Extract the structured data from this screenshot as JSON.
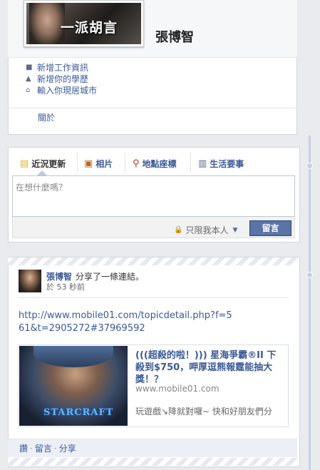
{
  "profile": {
    "name": "張博智",
    "picture_caption": "一派胡言",
    "info": [
      {
        "icon": "briefcase-icon",
        "label": "新增工作資訊"
      },
      {
        "icon": "graduation-cap-icon",
        "label": "新增你的學歷"
      },
      {
        "icon": "house-icon",
        "label": "輸入你現居城市"
      }
    ],
    "about_link": "關於"
  },
  "composer": {
    "tabs": [
      {
        "icon": "status-icon",
        "label": "近況更新"
      },
      {
        "icon": "photo-icon",
        "label": "相片"
      },
      {
        "icon": "place-icon",
        "label": "地點座標"
      },
      {
        "icon": "life-event-icon",
        "label": "生活要事"
      }
    ],
    "placeholder": "在想什麼嗎？",
    "privacy_label": "只限我本人",
    "post_button": "留言"
  },
  "story": {
    "author": "張博智",
    "action": "分享了一條連結。",
    "time": "於 53 秒前",
    "url": "http://www.mobile01.com/topicdetail.php?f=561&t=2905272#37969592",
    "share": {
      "title": "(((超殺的啦！))) 星海爭霸®II 下殺到$750，呷厚逗熊報霆能抽大獎！？",
      "domain": "www.mobile01.com",
      "description": "玩遊戲↘降就對囉~ 快和好朋友們分",
      "image_caption": "STARCRAFT"
    },
    "actions": [
      "讚",
      "留言",
      "分享"
    ]
  },
  "colors": {
    "link": "#3b5998",
    "button": "#5b74a8",
    "background": "#e9ebee"
  }
}
